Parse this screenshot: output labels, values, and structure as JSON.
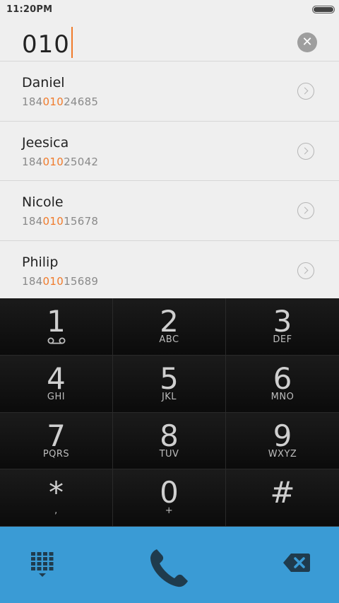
{
  "status_bar": {
    "time": "11:20PM"
  },
  "dial": {
    "input_value": "010",
    "clear_icon": "clear-icon"
  },
  "contacts": [
    {
      "name": "Daniel",
      "number_prefix": "184",
      "number_match": "010",
      "number_suffix": "24685"
    },
    {
      "name": "Jeesica",
      "number_prefix": "184",
      "number_match": "010",
      "number_suffix": "25042"
    },
    {
      "name": "Nicole",
      "number_prefix": "184",
      "number_match": "010",
      "number_suffix": "15678"
    },
    {
      "name": "Philip",
      "number_prefix": "184",
      "number_match": "010",
      "number_suffix": "15689"
    }
  ],
  "keypad": {
    "keys": [
      {
        "digit": "1",
        "letters": ""
      },
      {
        "digit": "2",
        "letters": "ABC"
      },
      {
        "digit": "3",
        "letters": "DEF"
      },
      {
        "digit": "4",
        "letters": "GHI"
      },
      {
        "digit": "5",
        "letters": "JKL"
      },
      {
        "digit": "6",
        "letters": "MNO"
      },
      {
        "digit": "7",
        "letters": "PQRS"
      },
      {
        "digit": "8",
        "letters": "TUV"
      },
      {
        "digit": "9",
        "letters": "WXYZ"
      },
      {
        "digit": "*",
        "letters": ","
      },
      {
        "digit": "0",
        "letters": "+"
      },
      {
        "digit": "#",
        "letters": ""
      }
    ]
  },
  "colors": {
    "highlight": "#f07b2b",
    "bottom_bar": "#3a9bd5",
    "icon_dark": "#1f3b4d"
  },
  "icons": {
    "dialpad": "dialpad-icon",
    "call": "phone-icon",
    "backspace": "backspace-icon",
    "voicemail": "voicemail-icon"
  }
}
